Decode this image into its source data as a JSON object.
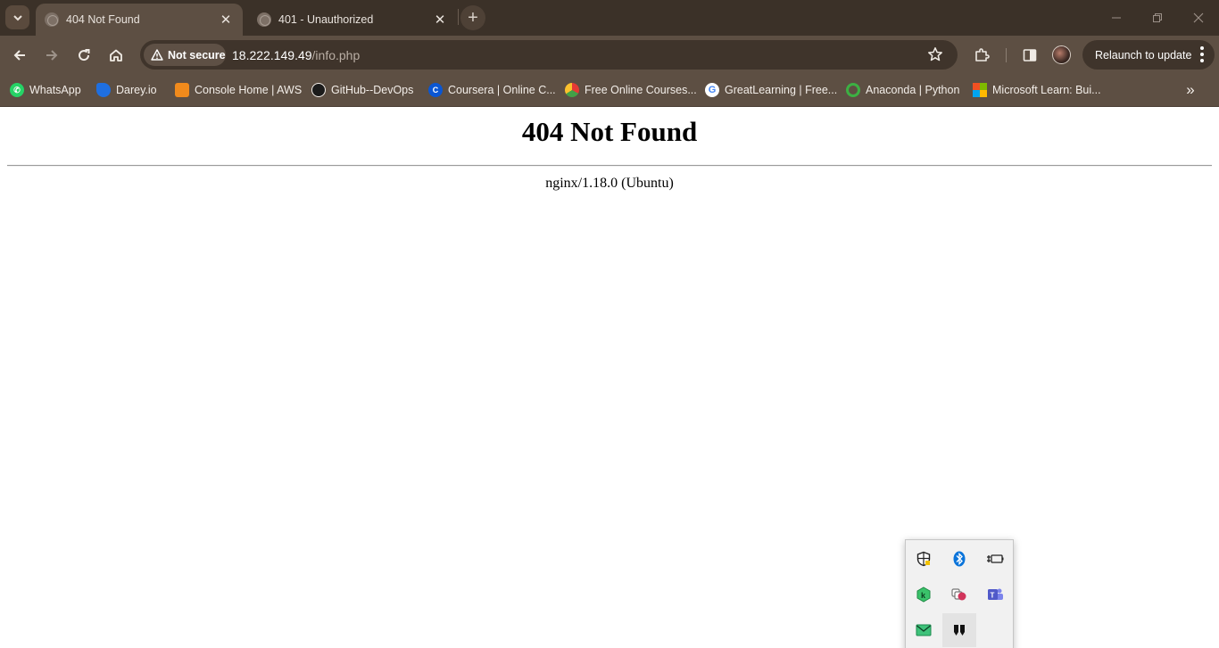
{
  "tabs": [
    {
      "title": "404 Not Found",
      "active": true
    },
    {
      "title": "401 - Unauthorized",
      "active": false
    }
  ],
  "toolbar": {
    "security_chip": "Not secure",
    "url_host": "18.222.149.49",
    "url_path": "/info.php",
    "relaunch_label": "Relaunch to update"
  },
  "bookmarks": [
    {
      "label": "WhatsApp",
      "icon": "whatsapp-icon"
    },
    {
      "label": "Darey.io",
      "icon": "darey-icon"
    },
    {
      "label": "Console Home | AWS",
      "icon": "aws-icon"
    },
    {
      "label": "GitHub--DevOps",
      "icon": "github-icon"
    },
    {
      "label": "Coursera | Online C...",
      "icon": "coursera-icon"
    },
    {
      "label": "Free Online Courses...",
      "icon": "courses-icon"
    },
    {
      "label": "GreatLearning | Free...",
      "icon": "google-icon"
    },
    {
      "label": "Anaconda | Python",
      "icon": "anaconda-icon"
    },
    {
      "label": "Microsoft Learn: Bui...",
      "icon": "microsoft-icon"
    }
  ],
  "page": {
    "heading": "404 Not Found",
    "server": "nginx/1.18.0 (Ubuntu)"
  },
  "tray": {
    "icons": [
      "security-shield-icon",
      "bluetooth-icon",
      "battery-plug-icon",
      "kaspersky-icon",
      "teams-status-icon",
      "teams-icon",
      "mail-icon",
      "notion-icon"
    ]
  },
  "colors": {
    "tabstrip": "#3b3128",
    "toolbar": "#5d4f43",
    "omnibox": "#3f342b"
  }
}
